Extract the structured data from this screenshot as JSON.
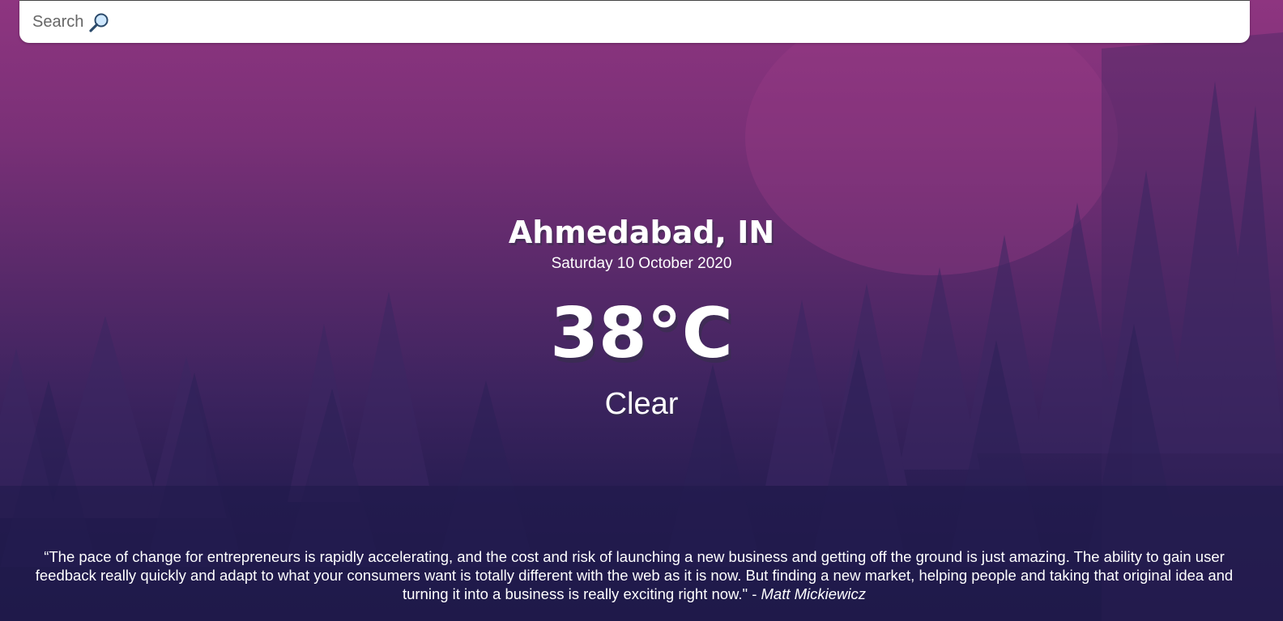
{
  "search": {
    "placeholder": "Search",
    "icon": "magnifying-glass-icon"
  },
  "location": {
    "city": "Ahmedabad, IN",
    "date": "Saturday 10 October 2020"
  },
  "weather": {
    "temperature": "38°C",
    "condition": "Clear"
  },
  "quote": {
    "text": "“The pace of change for entrepreneurs is rapidly accelerating, and the cost and risk of launching a new business and getting off the ground is just amazing. The ability to gain user feedback really quickly and adapt to what your consumers want is totally different with the web as it is now. But finding a new market, helping people and taking that original idea and turning it into a business is really exciting right now.\" -",
    "author": "Matt Mickiewicz"
  },
  "colors": {
    "sky_top": "#8e3580",
    "sky_bottom": "#1f1a4a",
    "text": "#ffffff",
    "search_bg": "#ffffff"
  }
}
